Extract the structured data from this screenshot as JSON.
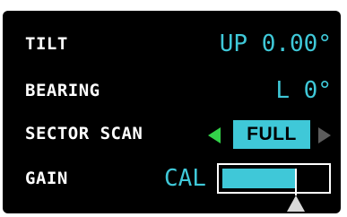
{
  "rows": {
    "tilt": {
      "label": "TILT",
      "value": "UP 0.00°"
    },
    "bearing": {
      "label": "BEARING",
      "value": "L 0°"
    },
    "sector_scan": {
      "label": "SECTOR SCAN",
      "value": "FULL"
    },
    "gain": {
      "label": "GAIN",
      "value": "CAL",
      "level": 0.7
    }
  },
  "colors": {
    "background": "#000000",
    "label": "#ffffff",
    "value": "#3fc8d8",
    "arrow_active": "#33d24a",
    "arrow_inactive": "#5c5c5c"
  },
  "icons": {
    "sector_prev": "left-triangle-icon",
    "sector_next": "right-triangle-icon",
    "gain_pointer": "pointer-triangle-icon"
  }
}
